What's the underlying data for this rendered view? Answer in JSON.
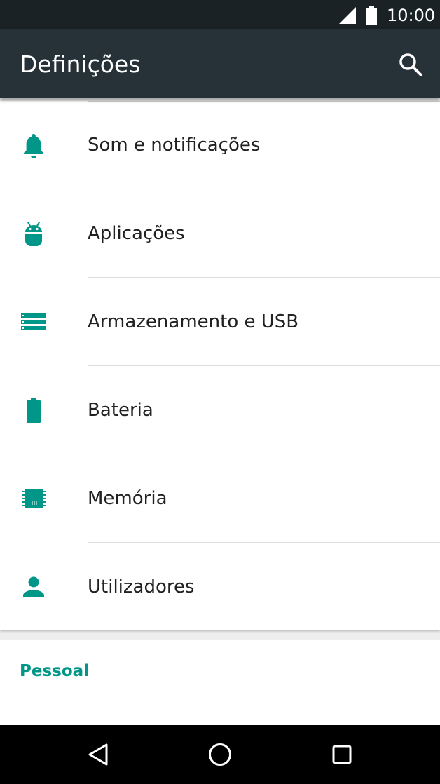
{
  "status_bar": {
    "time": "10:00",
    "icons": [
      "signal-icon",
      "battery-full-icon"
    ]
  },
  "app_bar": {
    "title": "Definições",
    "actions": [
      "search-icon"
    ]
  },
  "settings": [
    {
      "label": "Som e notificações",
      "icon": "bell-icon"
    },
    {
      "label": "Aplicações",
      "icon": "android-icon"
    },
    {
      "label": "Armazenamento e USB",
      "icon": "storage-icon"
    },
    {
      "label": "Bateria",
      "icon": "battery-icon"
    },
    {
      "label": "Memória",
      "icon": "memory-chip-icon"
    },
    {
      "label": "Utilizadores",
      "icon": "person-icon"
    }
  ],
  "section": {
    "header": "Pessoal"
  },
  "nav_bar": {
    "buttons": [
      "back-icon",
      "home-icon",
      "recents-icon"
    ]
  },
  "colors": {
    "accent": "#009688",
    "app_bar": "#263238",
    "status_bar": "#1a2226",
    "nav_bar": "#000000"
  }
}
